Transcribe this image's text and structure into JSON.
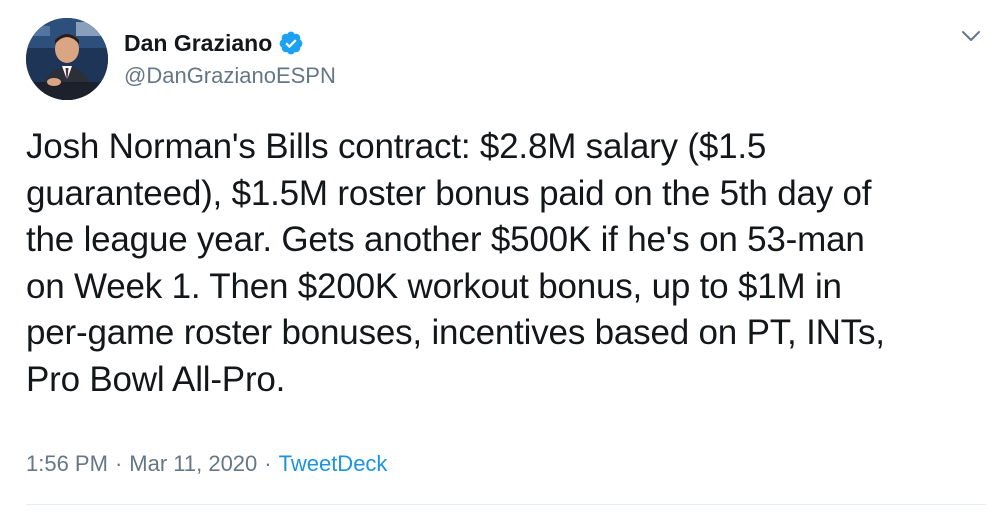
{
  "user": {
    "display_name": "Dan Graziano",
    "handle": "@DanGrazianoESPN",
    "verified": true,
    "avatar_icon": "profile-photo"
  },
  "tweet": {
    "text": "Josh Norman's Bills contract: $2.8M salary ($1.5\nguaranteed), $1.5M roster bonus paid on the 5th day of\nthe league year. Gets another $500K if he's on 53-man\non Week 1. Then $200K workout bonus, up to $1M in\nper-game roster bonuses, incentives based on PT, INTs,\nPro Bowl All-Pro.",
    "time": "1:56 PM",
    "separator": "·",
    "date": "Mar 11, 2020",
    "source": "TweetDeck"
  },
  "icons": {
    "verified": "verified-badge-icon",
    "menu": "chevron-down-icon"
  },
  "colors": {
    "text": "#14171a",
    "secondary": "#657786",
    "accent": "#1b95e0",
    "verified": "#1da1f2",
    "divider": "#e6ecf0"
  }
}
